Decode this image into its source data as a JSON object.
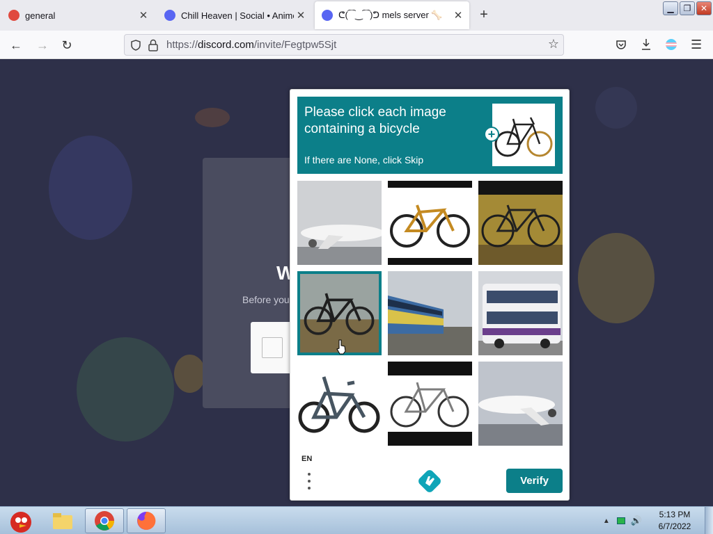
{
  "browser": {
    "tabs": [
      {
        "title": "general",
        "favicon": "discord-red-icon",
        "active": false
      },
      {
        "title": "Chill Heaven | Social • Anime",
        "favicon": "discord-icon",
        "active": false
      },
      {
        "title": "ᕦ(⁀‿⁀)ᕤ mels server 🦴",
        "favicon": "discord-icon",
        "active": true
      }
    ],
    "url": {
      "prefix": "https://",
      "domain": "discord.com",
      "path": "/invite/Fegtpw5Sjt"
    }
  },
  "page": {
    "heading_fragment": "W",
    "before_text": "Before you"
  },
  "captcha": {
    "prompt": "Please click each image containing a bicycle",
    "hint": "If there are None, click Skip",
    "language": "EN",
    "verify_label": "Verify",
    "tiles": [
      {
        "content": "airplane",
        "selected": false
      },
      {
        "content": "bicycle",
        "selected": false
      },
      {
        "content": "bicycle",
        "selected": false
      },
      {
        "content": "bicycle",
        "selected": true
      },
      {
        "content": "train",
        "selected": false
      },
      {
        "content": "bus",
        "selected": false
      },
      {
        "content": "bicycle",
        "selected": false
      },
      {
        "content": "bicycle",
        "selected": false
      },
      {
        "content": "airplane",
        "selected": false
      }
    ],
    "accent_color": "#0c7f89"
  },
  "taskbar": {
    "clock_time": "5:13 PM",
    "clock_date": "6/7/2022"
  }
}
